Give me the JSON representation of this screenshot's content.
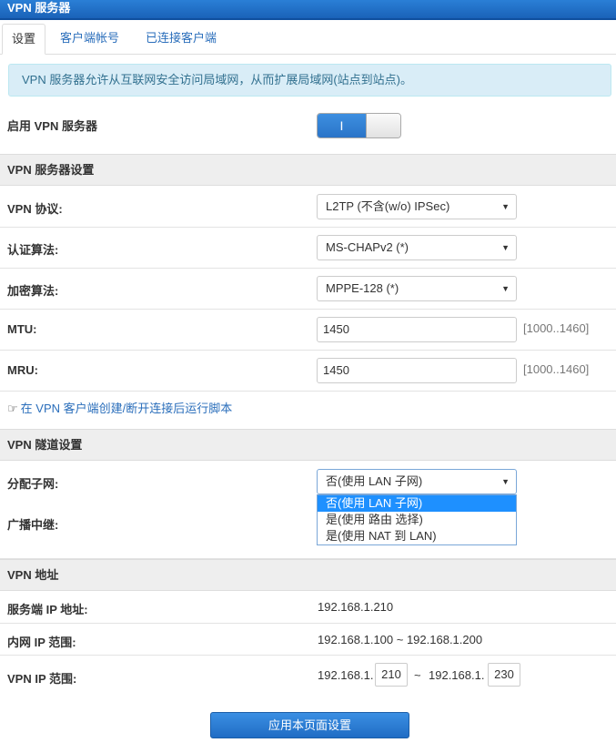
{
  "window": {
    "title": "VPN 服务器"
  },
  "tabs": [
    {
      "label": "设置",
      "active": true
    },
    {
      "label": "客户端帐号"
    },
    {
      "label": "已连接客户端"
    }
  ],
  "info_text": "VPN 服务器允许从互联网安全访问局域网，从而扩展局域网(站点到站点)。",
  "enable": {
    "label": "启用 VPN 服务器",
    "toggle_text": "I",
    "state": "on"
  },
  "server_settings": {
    "header": "VPN 服务器设置",
    "protocol": {
      "label": "VPN 协议:",
      "value": "L2TP (不含(w/o) IPSec)"
    },
    "auth": {
      "label": "认证算法:",
      "value": "MS-CHAPv2 (*)"
    },
    "encryption": {
      "label": "加密算法:",
      "value": "MPPE-128 (*)"
    },
    "mtu": {
      "label": "MTU:",
      "value": "1450",
      "hint": "[1000..1460]"
    },
    "mru": {
      "label": "MRU:",
      "value": "1450",
      "hint": "[1000..1460]"
    },
    "script_link": "在 VPN 客户端创建/断开连接后运行脚本",
    "script_icon": "hand-pointer-icon"
  },
  "tunnel": {
    "header": "VPN 隧道设置",
    "subnet": {
      "label": "分配子网:",
      "value": "否(使用 LAN 子网)",
      "options": [
        "否(使用 LAN 子网)",
        "是(使用 路由 选择)",
        "是(使用 NAT 到 LAN)"
      ]
    },
    "broadcast": {
      "label": "广播中继:"
    }
  },
  "addresses": {
    "header": "VPN 地址",
    "server_ip": {
      "label": "服务端 IP 地址:",
      "value": "192.168.1.210"
    },
    "lan_range": {
      "label": "内网 IP 范围:",
      "value": "192.168.1.100 ~ 192.168.1.200"
    },
    "vpn_range": {
      "label": "VPN IP 范围:",
      "prefix1": "192.168.1.",
      "start": "210",
      "sep": "~",
      "prefix2": "192.168.1.",
      "end": "230"
    }
  },
  "apply_button": "应用本页面设置"
}
